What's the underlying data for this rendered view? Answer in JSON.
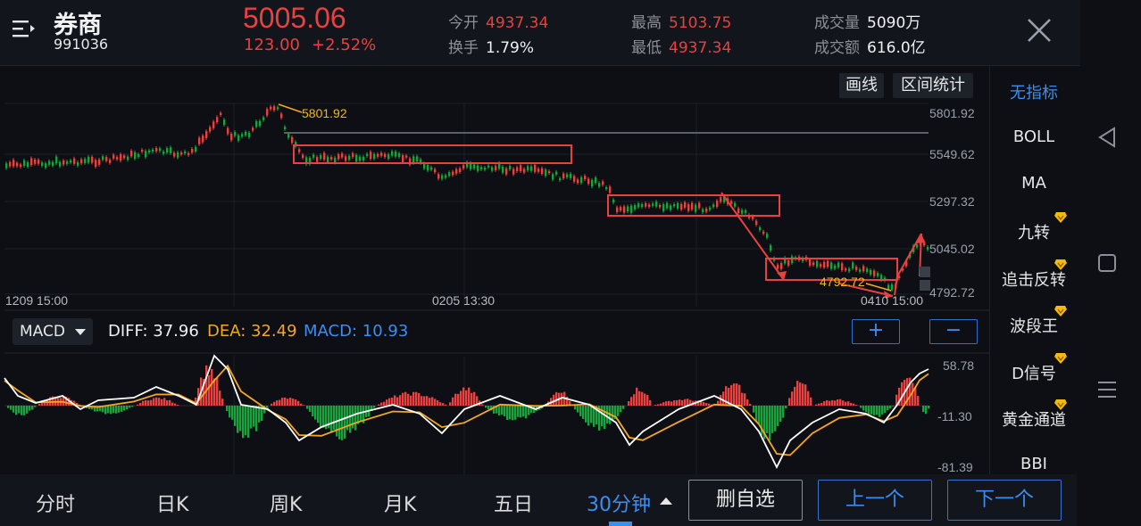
{
  "header": {
    "title": "券商",
    "code": "991036",
    "price": "5005.06",
    "change": "123.00",
    "change_pct": "+2.52%",
    "open_label": "今开",
    "open_value": "4937.34",
    "turnover_label": "换手",
    "turnover_value": "1.79%",
    "high_label": "最高",
    "high_value": "5103.75",
    "low_label": "最低",
    "low_value": "4937.34",
    "volume_label": "成交量",
    "volume_value": "5090万",
    "amount_label": "成交额",
    "amount_value": "616.0亿"
  },
  "tools": {
    "draw_label": "画线",
    "range_label": "区间统计"
  },
  "price_axis": [
    "5801.92",
    "5549.62",
    "5297.32",
    "5045.02",
    "4792.72"
  ],
  "annotations": {
    "high_mark": "5801.92",
    "low_mark": "4792.72"
  },
  "time_axis": [
    "1209  15:00",
    "0205  13:30",
    "0410  15:00"
  ],
  "macd": {
    "selector_label": "MACD",
    "diff_label": "DIFF: 37.96",
    "dea_label": "DEA: 32.49",
    "macd_label": "MACD: 10.93",
    "axis": [
      "58.78",
      "-11.30",
      "-81.39"
    ],
    "plus_label": "+",
    "minus_label": "−"
  },
  "indicators": [
    {
      "label": "无指标",
      "active": true,
      "vip": false
    },
    {
      "label": "BOLL",
      "active": false,
      "vip": false
    },
    {
      "label": "MA",
      "active": false,
      "vip": false
    },
    {
      "label": "九转",
      "active": false,
      "vip": true
    },
    {
      "label": "追击反转",
      "active": false,
      "vip": true
    },
    {
      "label": "波段王",
      "active": false,
      "vip": true
    },
    {
      "label": "D信号",
      "active": false,
      "vip": true
    },
    {
      "label": "黄金通道",
      "active": false,
      "vip": true
    },
    {
      "label": "BBI",
      "active": false,
      "vip": false
    }
  ],
  "tabs": [
    "分时",
    "日K",
    "周K",
    "月K",
    "五日",
    "30分钟"
  ],
  "buttons": {
    "remove_watch": "删自选",
    "prev": "上一个",
    "next": "下一个"
  },
  "colors": {
    "up": "#e8413f",
    "down": "#1aa33c",
    "accent": "#3b8ef0",
    "dea": "#f5a623",
    "vip": "#f5b90a"
  }
}
